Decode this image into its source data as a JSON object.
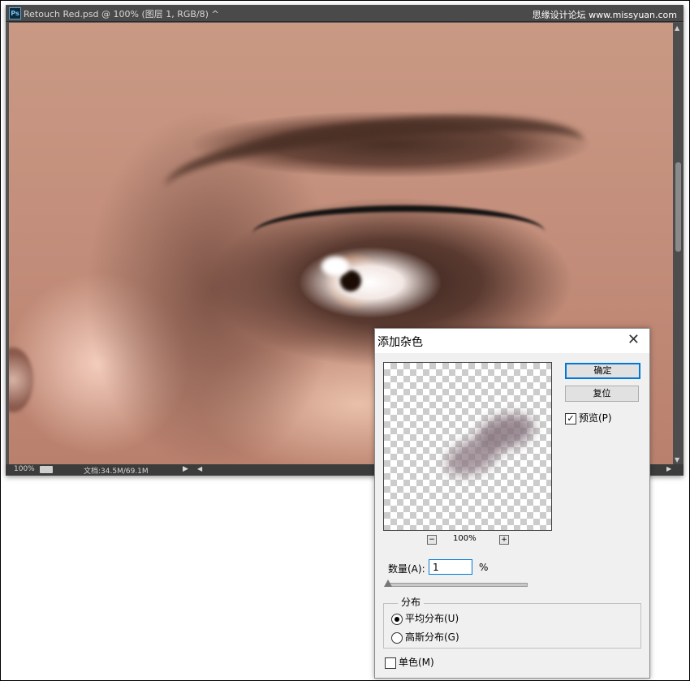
{
  "window": {
    "title": "Retouch Red.psd @ 100% (图层 1, RGB/8) ^",
    "app_icon_text": "Ps",
    "watermark": "思缘设计论坛 www.missyuan.com"
  },
  "statusbar": {
    "zoom": "100%",
    "doc_info": "文档:34.5M/69.1M",
    "arrow": "▶",
    "scroll_left": "◀",
    "scroll_right": "▶"
  },
  "dialog": {
    "title": "添加杂色",
    "close_glyph": "✕",
    "ok_label": "确定",
    "reset_label": "复位",
    "preview_label": "预览(P)",
    "preview_checked": true,
    "zoom_minus": "−",
    "zoom_plus": "+",
    "zoom_level": "100%",
    "amount_label": "数量(A):",
    "amount_value": "1",
    "amount_unit": "%",
    "distribution_title": "分布",
    "uniform_label": "平均分布(U)",
    "gaussian_label": "高斯分布(G)",
    "selected_distribution": "uniform",
    "monochromatic_label": "单色(M)",
    "monochromatic_checked": false
  }
}
